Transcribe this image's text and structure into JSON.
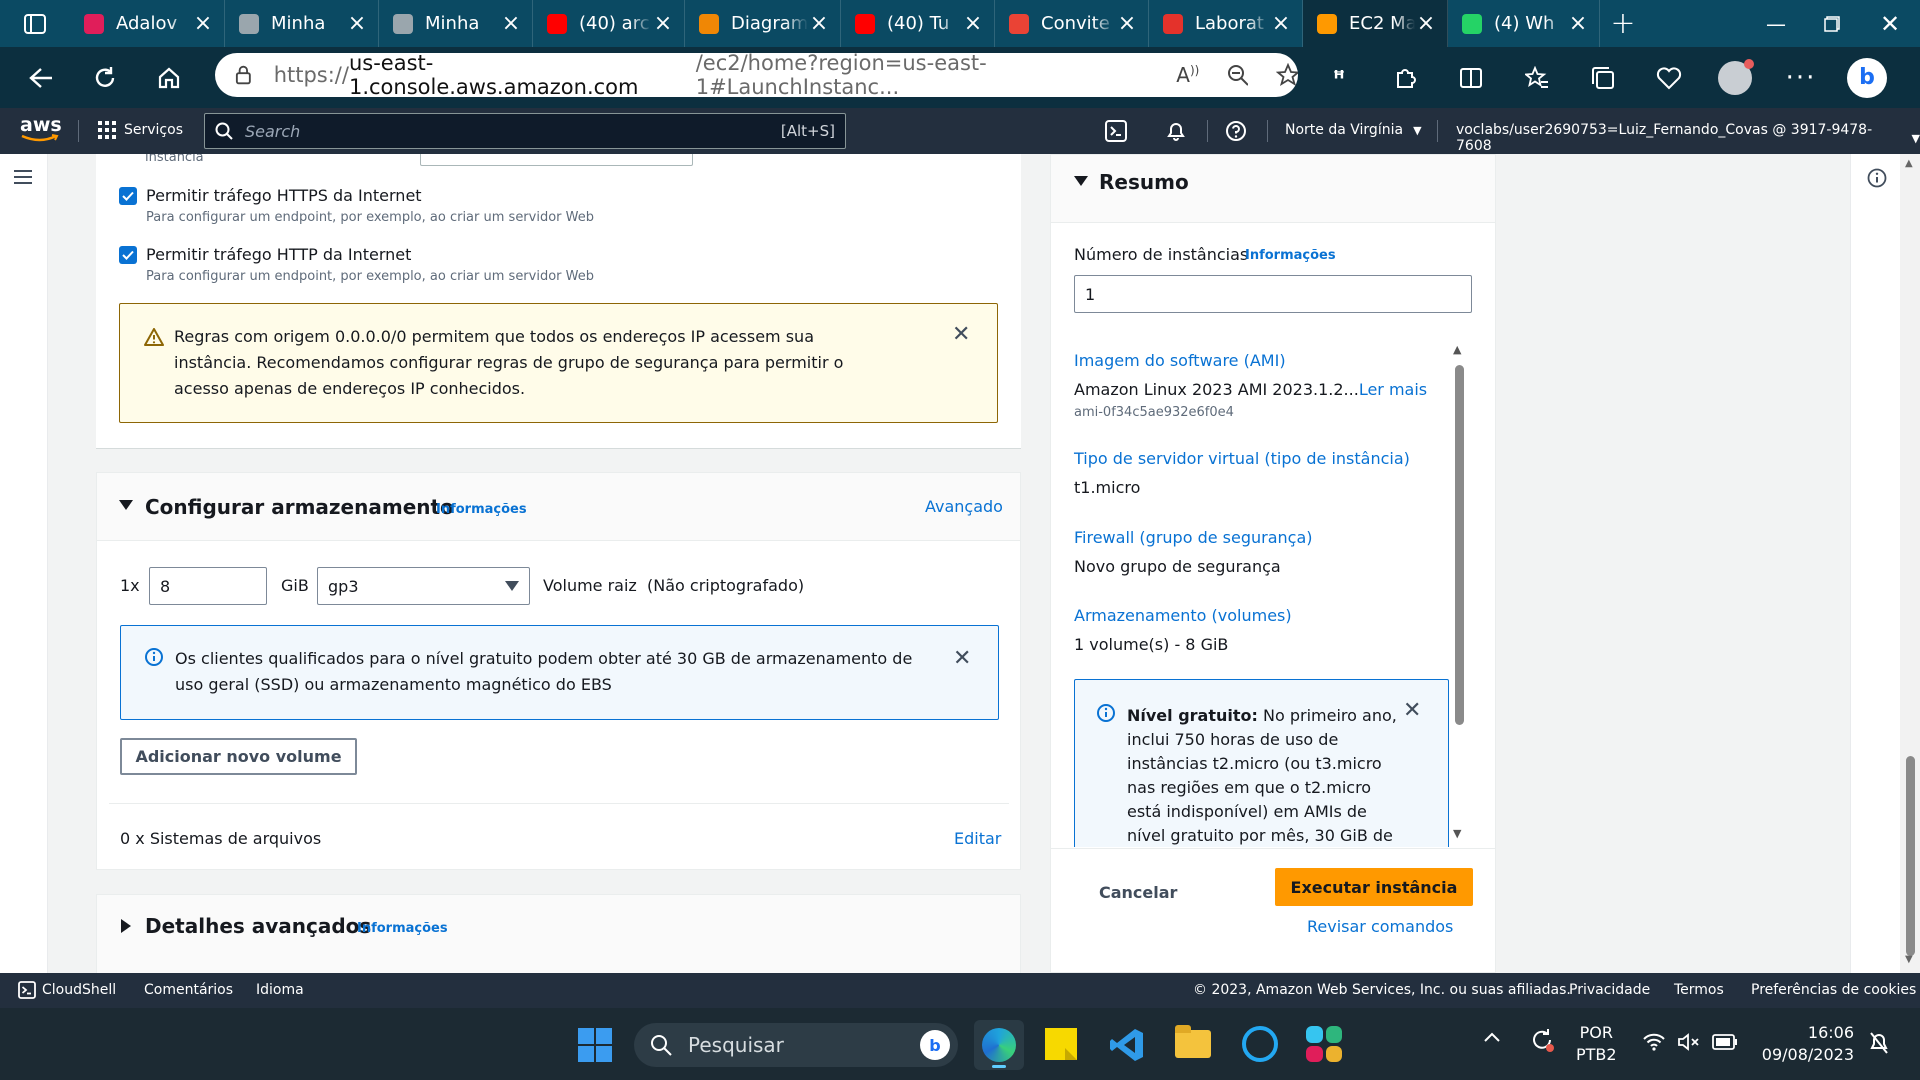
{
  "browser": {
    "tabs": [
      {
        "title": "Adalov",
        "icon": "slack-icon",
        "color": "#e01e5a"
      },
      {
        "title": "Minha",
        "icon": "cloud-icon",
        "color": "#9aa6ad"
      },
      {
        "title": "Minha",
        "icon": "cloud-icon",
        "color": "#9aa6ad"
      },
      {
        "title": "(40) arc",
        "icon": "youtube-icon",
        "color": "#ff0000"
      },
      {
        "title": "Diagram",
        "icon": "drawio-icon",
        "color": "#f08705"
      },
      {
        "title": "(40) Tu",
        "icon": "youtube-icon",
        "color": "#ff0000"
      },
      {
        "title": "Convite",
        "icon": "gmail-icon",
        "color": "#ea4335"
      },
      {
        "title": "Laborat",
        "icon": "canvas-icon",
        "color": "#e4322b"
      },
      {
        "title": "EC2 Ma",
        "icon": "aws-service-icon",
        "color": "#ff9900",
        "active": true
      },
      {
        "title": "(4) Wh",
        "icon": "whatsapp-icon",
        "color": "#25d366"
      }
    ],
    "url_prefix": "https://",
    "url_domain": "us-east-1.console.aws.amazon.com",
    "url_path": "/ec2/home?region=us-east-1#LaunchInstanc..."
  },
  "aws_header": {
    "logo": "aws",
    "services": "Serviços",
    "search_placeholder": "Search",
    "search_shortcut": "[Alt+S]",
    "region": "Norte da Virgínia",
    "account": "voclabs/user2690753=Luiz_Fernando_Covas @ 3917-9478-7608"
  },
  "network": {
    "truncated_label": "instância",
    "https": {
      "label": "Permitir tráfego HTTPS da Internet",
      "desc": "Para configurar um endpoint, por exemplo, ao criar um servidor Web",
      "checked": true
    },
    "http": {
      "label": "Permitir tráfego HTTP da Internet",
      "desc": "Para configurar um endpoint, por exemplo, ao criar um servidor Web",
      "checked": true
    },
    "warning": "Regras com origem 0.0.0.0/0 permitem que todos os endereços IP acessem sua instância. Recomendamos configurar regras de grupo de segurança para permitir o acesso apenas de endereços IP conhecidos."
  },
  "storage": {
    "title": "Configurar armazenamento",
    "info": "Informações",
    "advanced": "Avançado",
    "multiplier": "1x",
    "size": "8",
    "unit": "GiB",
    "volume_type": "gp3",
    "root_label": "Volume raiz",
    "encryption": "(Não criptografado)",
    "free_tier_note": "Os clientes qualificados para o nível gratuito podem obter até 30 GB de armazenamento de uso geral (SSD) ou armazenamento magnético do EBS",
    "add_volume": "Adicionar novo volume",
    "filesystems": "0 x Sistemas de arquivos",
    "edit": "Editar"
  },
  "advanced_details": {
    "title": "Detalhes avançados",
    "info": "Informações"
  },
  "summary": {
    "title": "Resumo",
    "instances_label": "Número de instâncias",
    "instances_info": "Informações",
    "instances_value": "1",
    "ami_label": "Imagem do software (AMI)",
    "ami_value": "Amazon Linux 2023 AMI 2023.1.2...",
    "ami_more": "Ler mais",
    "ami_id": "ami-0f34c5ae932e6f0e4",
    "type_label": "Tipo de servidor virtual (tipo de instância)",
    "type_value": "t1.micro",
    "firewall_label": "Firewall (grupo de segurança)",
    "firewall_value": "Novo grupo de segurança",
    "storage_label": "Armazenamento (volumes)",
    "storage_value": "1 volume(s) - 8 GiB",
    "free_tier_title": "Nível gratuito:",
    "free_tier_text": " No primeiro ano, inclui 750 horas de uso de instâncias t2.micro (ou t3.micro nas regiões em que o t2.micro está indisponível) em AMIs de nível gratuito por mês, 30 GiB de",
    "cancel": "Cancelar",
    "launch": "Executar instância",
    "review": "Revisar comandos"
  },
  "aws_footer": {
    "cloudshell": "CloudShell",
    "feedback": "Comentários",
    "language": "Idioma",
    "copyright": "© 2023, Amazon Web Services, Inc. ou suas afiliadas.",
    "privacy": "Privacidade",
    "terms": "Termos",
    "cookies": "Preferências de cookies"
  },
  "taskbar": {
    "search": "Pesquisar",
    "lang1": "POR",
    "lang2": "PTB2",
    "time": "16:06",
    "date": "09/08/2023"
  },
  "colors": {
    "aws_orange": "#ff9900",
    "aws_link": "#0972d3",
    "aws_dark": "#232f3e"
  }
}
